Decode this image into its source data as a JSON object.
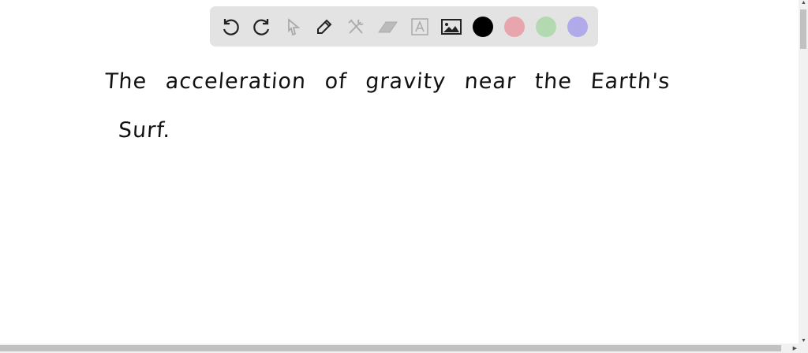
{
  "toolbar": {
    "tools": [
      "undo-icon",
      "redo-icon",
      "select-icon",
      "pen-icon",
      "tools-icon",
      "eraser-icon",
      "text-icon",
      "image-icon"
    ],
    "colors": [
      "#000000",
      "#e8a5ae",
      "#b3d9b0",
      "#b1aaea"
    ]
  },
  "canvas": {
    "line1": "The acceleration of gravity near the Earth's",
    "line2": "Surf."
  }
}
